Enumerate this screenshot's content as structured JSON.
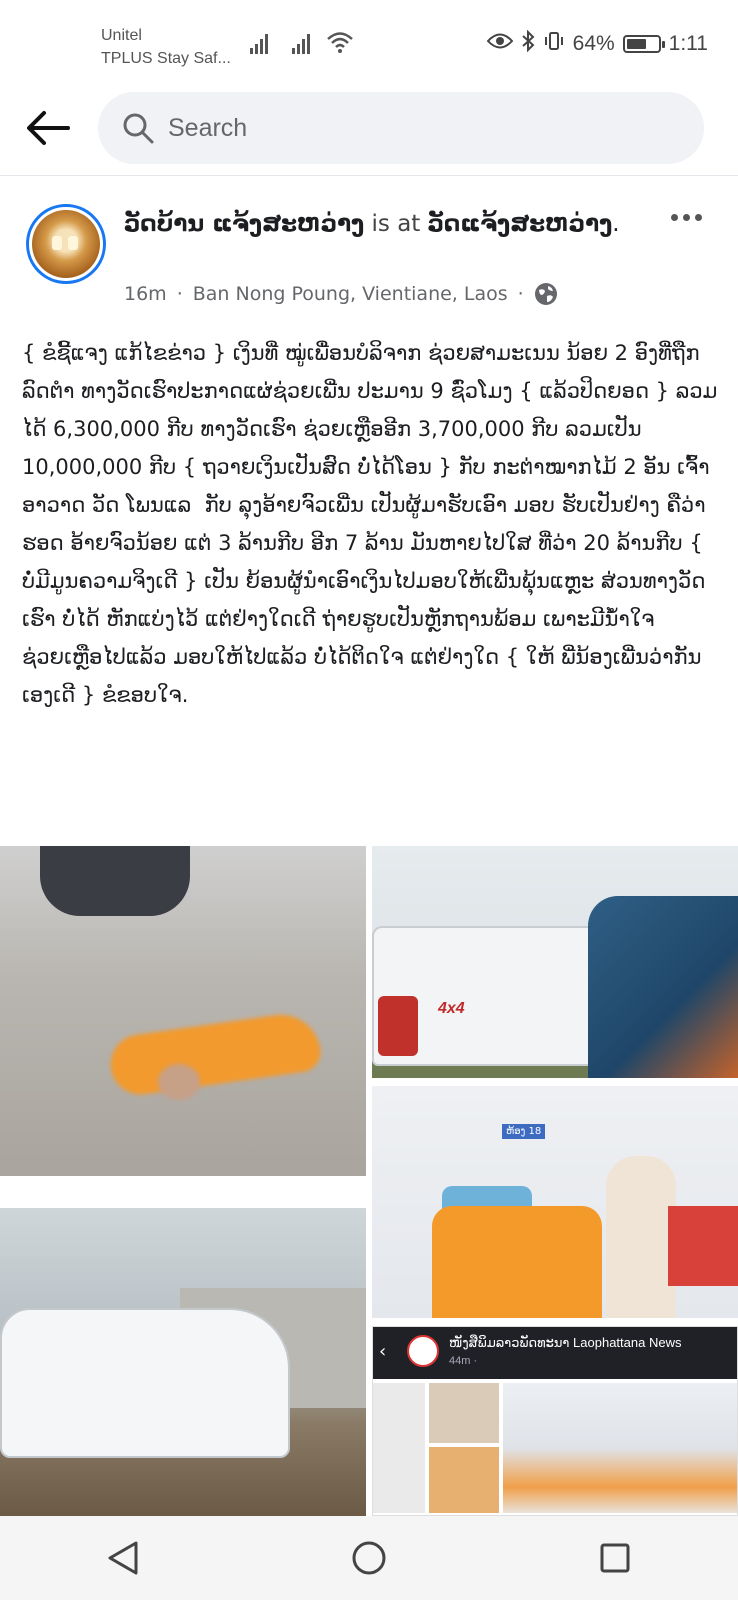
{
  "status_bar": {
    "carrier_line1": "Unitel",
    "carrier_line2": "TPLUS Stay Saf...",
    "battery_percent": "64%",
    "battery_level": 0.64,
    "time": "1:11"
  },
  "search": {
    "placeholder": "Search"
  },
  "post": {
    "author": "ວັດບ້ານ ແຈ້ງສະຫວ່າງ",
    "is_at": "is at",
    "location_name": "ວັດແຈ້ງສະຫວ່າງ",
    "location_suffix": ".",
    "time": "16m",
    "dot1": "·",
    "place": "Ban Nong Poung, Vientiane, Laos",
    "dot2": "·",
    "body": "{ ຂໍຊີ້ແຈງ ແກ້ໄຂຂ່າວ } ເງິນທີ່ ໝູ່ເພື່ອນບໍລິຈາກ ຊ່ວຍສາມະເນນ ນ້ອຍ 2 ອົງທີ່ຖືກລົດຕຳ ທາງວັດເຮົາປະກາດແຜ່ຊ່ວຍເພີ່ນ ປະມານ 9 ຊົ່ວໂມງ { ແລ້ວປິດຍອດ } ລວມໄດ້ 6,300,000 ກີບ ທາງວັດເຮົາ ຊ່ວຍເຫຼືອອີກ 3,700,000 ກີບ ລວມເປັນ 10,000,000 ກີບ { ຖວາຍເງິນເປັນສົດ ບໍ່ໄດ້ໂອນ } ກັບ ກະຕ່າໝາກໄມ້ 2 ອັນ ເຈົ້າ ອາວາດ ວັດ ໂພນແລ  ກັບ ລຸງອ້າຍຈົວເພີ່ນ ເປັນຜູ້ມາຮັບເອົາ ມອບ ຮັບເປັນຢ່າງ ຄືວ່າຮອດ ອ້າຍຈົວນ້ອຍ ແຕ່ 3 ລ້ານກີບ ອີກ 7 ລ້ານ ມັນຫາຍໄປໃສ ທີ່ວ່າ 20 ລ້ານກີບ { ບໍ່ມີມູນຄວາມຈິງເດີ } ເປັນ ຍ້ອນຜູ້ນຳເອົາເງິນໄປມອບໃຫ້ເພີ່ນພຸ້ນແຫຼະ ສ່ວນທາງວັດເຮົາ ບໍ່ໄດ້ ຫັກແບ່ງໄວ້ ແຕ່ຢ່າງໃດເດີ ຖ່າຍຮູບເປັນຫຼັກຖານພ້ອມ ເພາະມີນ້ຳໃຈ ຊ່ວຍເຫຼືອໄປແລ້ວ ມອບໃຫ້ໄປແລ້ວ ບໍ່ໄດ້ຕິດໃຈ ແຕ່ຢ່າງໃດ { ໃຫ້ ພີ່ນ້ອງເພີ່ນວ່າກັນເອງເດີ } ຂໍຂອບໃຈ."
  },
  "photos": {
    "truck_badge": "4x4",
    "room_sign": "ຫ້ອງ 18",
    "share_page_name": "ໜັງສືພິມລາວພັດທະນາ Laophattana News",
    "share_time": "44m · "
  },
  "icons": {
    "back": "arrow-left",
    "search": "magnifier",
    "more": "three-dots",
    "privacy": "globe",
    "nav_back": "triangle",
    "nav_home": "circle",
    "nav_recent": "square"
  },
  "colors": {
    "accent": "#1877f2",
    "search_bg": "#f0f2f5",
    "muted_text": "#65676b"
  }
}
